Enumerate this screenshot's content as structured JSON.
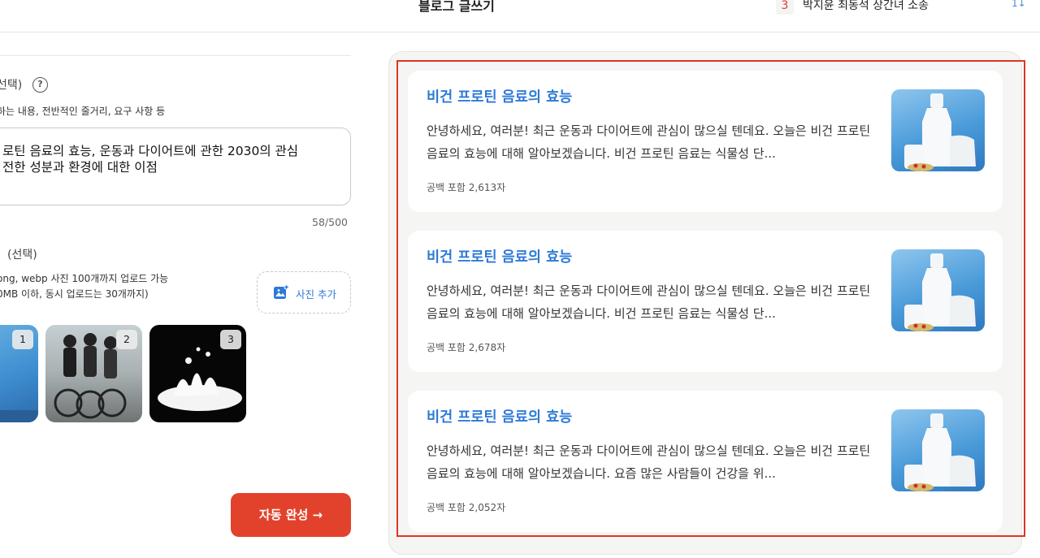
{
  "header": {
    "title": "블로그 글쓰기",
    "trend_rank": "3",
    "trend_text": "박지윤 최동석 상간녀 소송",
    "trend_indicator": "1↓"
  },
  "form": {
    "content_label": "선택)",
    "content_hint": "하는 내용, 전반적인 줄거리, 요구 사항 등",
    "content_value": "로틴 음료의 효능, 운동과 다이어트에 관한 2030의 관심\n전한 성분과 환경에 대한 이점",
    "char_counter": "58/500",
    "photo_label": "(선택)",
    "photo_hint": "ong, webp 사진 100개까지 업로드 가능\n0MB 이하, 동시 업로드는 30개까지)",
    "add_photo_label": "사진 추가",
    "thumbnails": [
      {
        "num": "1"
      },
      {
        "num": "2"
      },
      {
        "num": "3"
      }
    ],
    "autocomplete_label": "자동 완성 →"
  },
  "results": [
    {
      "title": "비건 프로틴 음료의 효능",
      "body": "안녕하세요, 여러분! 최근 운동과 다이어트에 관심이 많으실 텐데요. 오늘은 비건 프로틴 음료의 효능에 대해 알아보겠습니다. 비건 프로틴 음료는 식물성 단...",
      "meta": "공백 포함 2,613자"
    },
    {
      "title": "비건 프로틴 음료의 효능",
      "body": "안녕하세요, 여러분! 최근 운동과 다이어트에 관심이 많으실 텐데요. 오늘은 비건 프로틴 음료의 효능에 대해 알아보겠습니다. 비건 프로틴 음료는 식물성 단...",
      "meta": "공백 포함 2,678자"
    },
    {
      "title": "비건 프로틴 음료의 효능",
      "body": "안녕하세요, 여러분! 최근 운동과 다이어트에 관심이 많으실 텐데요. 오늘은 비건 프로틴 음료의 효능에 대해 알아보겠습니다. 요즘 많은 사람들이 건강을 위...",
      "meta": "공백 포함 2,052자"
    }
  ],
  "colors": {
    "accent_blue": "#2d7ad6",
    "accent_red": "#e2422b",
    "highlight_red": "#e03525"
  }
}
